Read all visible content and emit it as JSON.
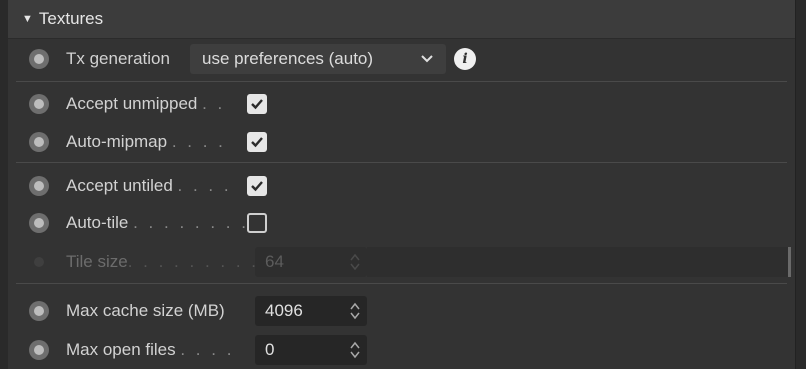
{
  "section": {
    "title": "Textures",
    "expander_icon": "triangle-down-icon"
  },
  "tx_generation": {
    "label": "Tx generation",
    "value": "use preferences (auto)",
    "info_glyph": "i"
  },
  "accept_unmipped": {
    "label": "Accept unmipped",
    "dots": ". .",
    "checked": true
  },
  "auto_mipmap": {
    "label": "Auto-mipmap",
    "dots": ". . . .",
    "checked": true
  },
  "accept_untiled": {
    "label": "Accept untiled",
    "dots": ". . . .",
    "checked": true
  },
  "auto_tile": {
    "label": "Auto-tile",
    "dots": ". . . . . . . .",
    "checked": false
  },
  "tile_size": {
    "label": "Tile size",
    "dots": ". . . . . . . . .",
    "value": "64",
    "disabled": true
  },
  "max_cache_size": {
    "label": "Max cache size (MB)",
    "value": "4096"
  },
  "max_open_files": {
    "label": "Max open files",
    "dots": ". . . .",
    "value": "0"
  },
  "colors": {
    "panel": "#333333",
    "header": "#3c3c3c",
    "field": "#262626",
    "text": "#d2d2d2",
    "disabled_text": "#6c6c6c"
  }
}
